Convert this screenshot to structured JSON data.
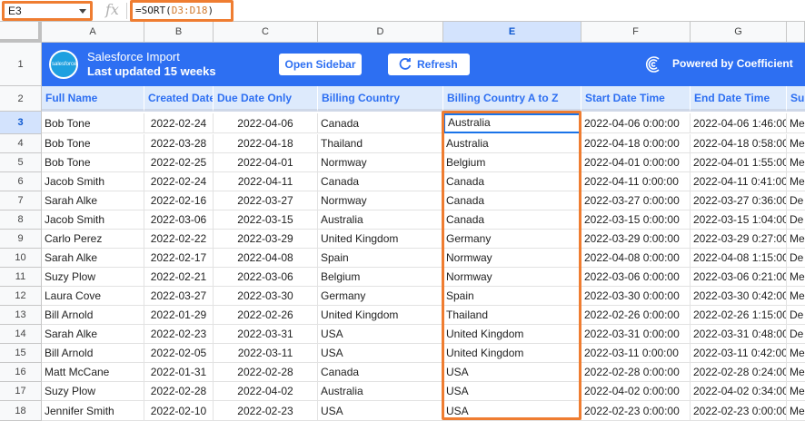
{
  "formula_bar": {
    "name_box": "E3",
    "fx": "fx",
    "formula_prefix": "=SORT(",
    "formula_ref": "D3:D18",
    "formula_suffix": ")"
  },
  "columns": [
    "A",
    "B",
    "C",
    "D",
    "E",
    "F",
    "G"
  ],
  "rows": [
    "1",
    "2",
    "3",
    "4",
    "5",
    "6",
    "7",
    "8",
    "9",
    "10",
    "11",
    "12",
    "13",
    "14",
    "15",
    "16",
    "17",
    "18"
  ],
  "banner": {
    "logo_text": "salesforce",
    "title": "Salesforce Import",
    "subtitle": "Last updated 15 weeks",
    "open_sidebar": "Open Sidebar",
    "refresh": "Refresh",
    "powered_by": "Powered by Coefficient"
  },
  "headers": [
    "Full Name",
    "Created Date",
    "Due Date Only",
    "Billing Country",
    "Billing Country A to Z",
    "Start Date Time",
    "End Date Time",
    "Su"
  ],
  "data": [
    [
      "Bob Tone",
      "2022-02-24",
      "2022-04-06",
      "Canada",
      "Australia",
      "2022-04-06 0:00:00",
      "2022-04-06 1:46:00",
      "Me"
    ],
    [
      "Bob Tone",
      "2022-03-28",
      "2022-04-18",
      "Thailand",
      "Australia",
      "2022-04-18 0:00:00",
      "2022-04-18 0:58:00",
      "Me"
    ],
    [
      "Bob Tone",
      "2022-02-25",
      "2022-04-01",
      "Normway",
      "Belgium",
      "2022-04-01 0:00:00",
      "2022-04-01 1:55:00",
      "Me"
    ],
    [
      "Jacob Smith",
      "2022-02-24",
      "2022-04-11",
      "Canada",
      "Canada",
      "2022-04-11 0:00:00",
      "2022-04-11 0:41:00",
      "Me"
    ],
    [
      "Sarah Alke",
      "2022-02-16",
      "2022-03-27",
      "Normway",
      "Canada",
      "2022-03-27 0:00:00",
      "2022-03-27 0:36:00",
      "De"
    ],
    [
      "Jacob Smith",
      "2022-03-06",
      "2022-03-15",
      "Australia",
      "Canada",
      "2022-03-15 0:00:00",
      "2022-03-15 1:04:00",
      "De"
    ],
    [
      "Carlo Perez",
      "2022-02-22",
      "2022-03-29",
      "United Kingdom",
      "Germany",
      "2022-03-29 0:00:00",
      "2022-03-29 0:27:00",
      "Me"
    ],
    [
      "Sarah Alke",
      "2022-02-17",
      "2022-04-08",
      "Spain",
      "Normway",
      "2022-04-08 0:00:00",
      "2022-04-08 1:15:00",
      "De"
    ],
    [
      "Suzy Plow",
      "2022-02-21",
      "2022-03-06",
      "Belgium",
      "Normway",
      "2022-03-06 0:00:00",
      "2022-03-06 0:21:00",
      "Me"
    ],
    [
      "Laura Cove",
      "2022-03-27",
      "2022-03-30",
      "Germany",
      "Spain",
      "2022-03-30 0:00:00",
      "2022-03-30 0:42:00",
      "Me"
    ],
    [
      "Bill Arnold",
      "2022-01-29",
      "2022-02-26",
      "United Kingdom",
      "Thailand",
      "2022-02-26 0:00:00",
      "2022-02-26 1:15:00",
      "De"
    ],
    [
      "Sarah Alke",
      "2022-02-23",
      "2022-03-31",
      "USA",
      "United Kingdom",
      "2022-03-31 0:00:00",
      "2022-03-31 0:48:00",
      "De"
    ],
    [
      "Bill Arnold",
      "2022-02-05",
      "2022-03-11",
      "USA",
      "United Kingdom",
      "2022-03-11 0:00:00",
      "2022-03-11 0:42:00",
      "Me"
    ],
    [
      "Matt McCane",
      "2022-01-31",
      "2022-02-28",
      "Canada",
      "USA",
      "2022-02-28 0:00:00",
      "2022-02-28 0:24:00",
      "Me"
    ],
    [
      "Suzy Plow",
      "2022-02-28",
      "2022-04-02",
      "Australia",
      "USA",
      "2022-04-02 0:00:00",
      "2022-04-02 0:34:00",
      "Me"
    ],
    [
      "Jennifer Smith",
      "2022-02-10",
      "2022-02-23",
      "USA",
      "USA",
      "2022-02-23 0:00:00",
      "2022-02-23 0:00:00",
      "Me"
    ]
  ],
  "colors": {
    "accent": "#2d6ff2",
    "highlight": "#ef7d31",
    "selection": "#1a73e8"
  }
}
